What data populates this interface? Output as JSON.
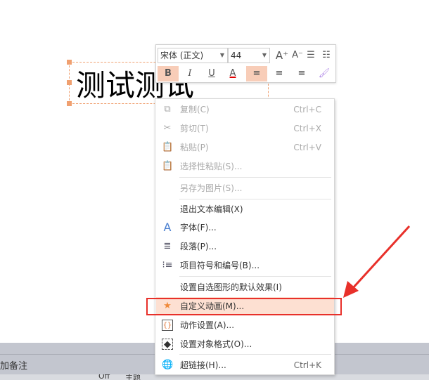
{
  "slide": {
    "text": "测试测试"
  },
  "toolbar": {
    "font_name": "宋体 (正文)",
    "font_size": "44",
    "grow_font": "A⁺",
    "shrink_font": "A⁻",
    "bold": "B",
    "italic": "I",
    "underline": "U",
    "font_color": "A",
    "font_color_value": "#e00000"
  },
  "menu": {
    "items": [
      {
        "label": "复制(C)",
        "shortcut": "Ctrl+C",
        "icon": "copy-icon",
        "disabled": true
      },
      {
        "label": "剪切(T)",
        "shortcut": "Ctrl+X",
        "icon": "scissors-icon",
        "disabled": true
      },
      {
        "label": "粘贴(P)",
        "shortcut": "Ctrl+V",
        "icon": "paste-icon",
        "disabled": true
      },
      {
        "label": "选择性粘贴(S)...",
        "shortcut": "",
        "icon": "paste-special-icon",
        "disabled": true
      },
      {
        "label": "另存为图片(S)...",
        "shortcut": "",
        "icon": "",
        "disabled": true
      },
      {
        "label": "退出文本编辑(X)",
        "shortcut": "",
        "icon": "",
        "disabled": false
      },
      {
        "label": "字体(F)...",
        "shortcut": "",
        "icon": "font-icon",
        "disabled": false
      },
      {
        "label": "段落(P)...",
        "shortcut": "",
        "icon": "paragraph-icon",
        "disabled": false
      },
      {
        "label": "项目符号和编号(B)...",
        "shortcut": "",
        "icon": "bullets-icon",
        "disabled": false
      },
      {
        "label": "设置自选图形的默认效果(I)",
        "shortcut": "",
        "icon": "",
        "disabled": false
      },
      {
        "label": "自定义动画(M)...",
        "shortcut": "",
        "icon": "custom-animation-icon",
        "disabled": false,
        "highlighted": true
      },
      {
        "label": "动作设置(A)...",
        "shortcut": "",
        "icon": "action-settings-icon",
        "disabled": false
      },
      {
        "label": "设置对象格式(O)...",
        "shortcut": "",
        "icon": "format-object-icon",
        "disabled": false
      },
      {
        "label": "超链接(H)...",
        "shortcut": "Ctrl+K",
        "icon": "hyperlink-icon",
        "disabled": false
      }
    ]
  },
  "notes": {
    "placeholder": "加备注"
  },
  "status": {
    "theme_partial": "Off",
    "theme_label": "主题"
  },
  "colors": {
    "accent": "#f0a070",
    "highlight": "#fde0d2",
    "annotation": "#e8302a"
  }
}
